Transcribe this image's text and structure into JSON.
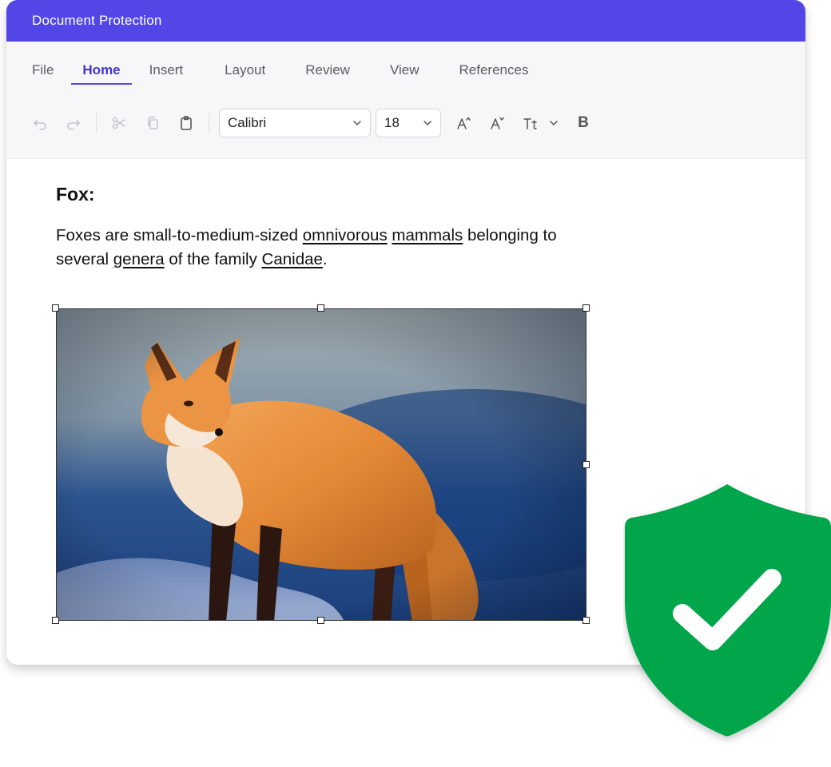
{
  "window": {
    "title": "Document Protection"
  },
  "tabs": [
    {
      "label": "File"
    },
    {
      "label": "Home"
    },
    {
      "label": "Insert"
    },
    {
      "label": "Layout"
    },
    {
      "label": "Review"
    },
    {
      "label": "View"
    },
    {
      "label": "References"
    }
  ],
  "toolbar": {
    "font": "Calibri",
    "size": "18",
    "bold": "B",
    "icons": [
      "undo-icon",
      "redo-icon",
      "cut-icon",
      "copy-icon",
      "paste-icon",
      "grow-font-icon",
      "shrink-font-icon",
      "change-case-icon",
      "chevron-down-icon",
      "bold-icon"
    ]
  },
  "document": {
    "heading": "Fox:",
    "para_1": "Foxes are small-to-medium-sized ",
    "link_1": "omnivorous",
    "para_2": " ",
    "link_2": "mammals",
    "para_3": " belonging to several ",
    "link_3": "genera",
    "para_4": " of the family ",
    "link_4": "Canidae",
    "para_5": "."
  },
  "colors": {
    "accent": "#5247e6",
    "shield": "#05a64a",
    "check": "#ffffff"
  }
}
